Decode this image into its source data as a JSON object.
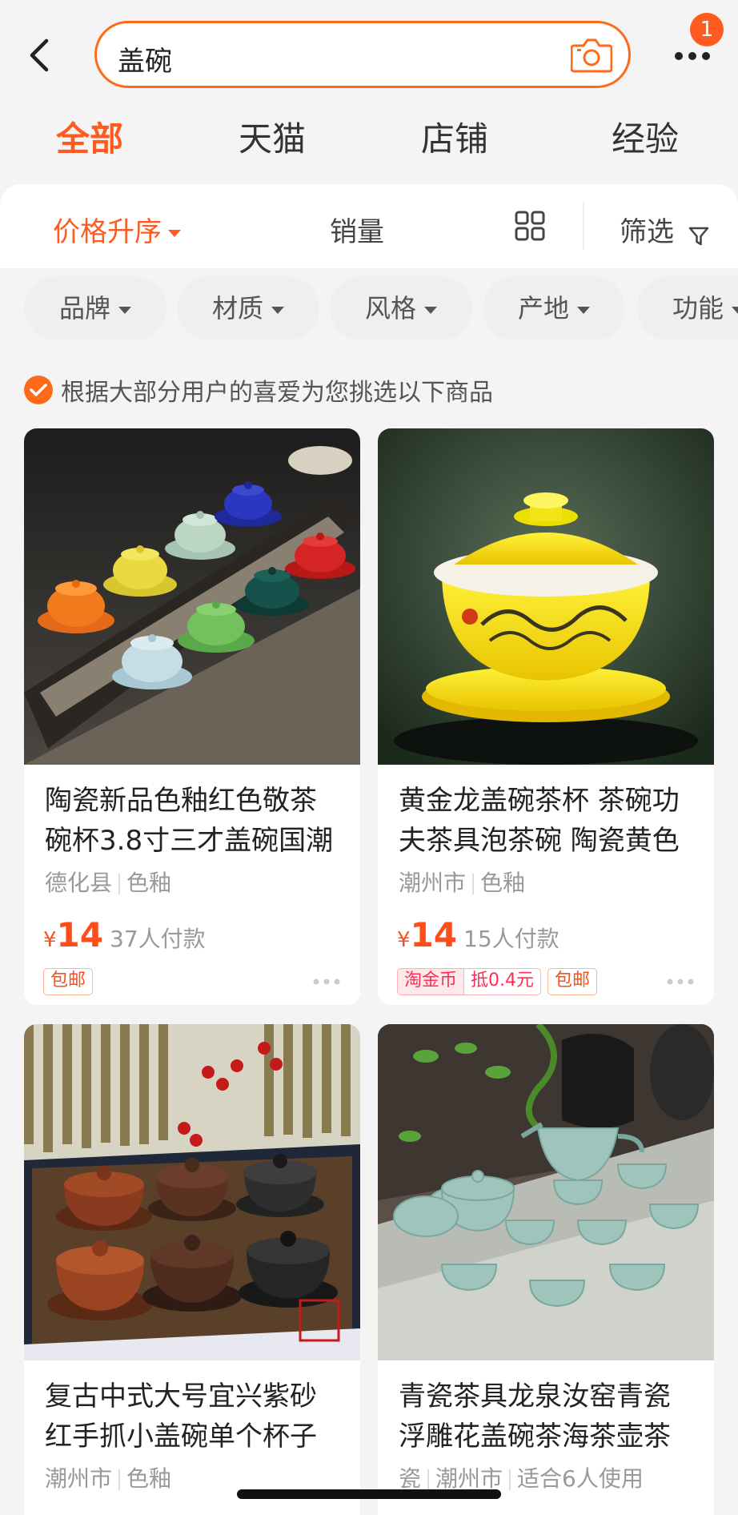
{
  "search": {
    "query": "盖碗",
    "notification_count": "1"
  },
  "tabs": [
    {
      "label": "全部",
      "active": true
    },
    {
      "label": "天猫",
      "active": false
    },
    {
      "label": "店铺",
      "active": false
    },
    {
      "label": "经验",
      "active": false
    }
  ],
  "sort": {
    "price_asc": "价格升序",
    "sales": "销量",
    "filter": "筛选"
  },
  "filter_chips": [
    "品牌",
    "材质",
    "风格",
    "产地",
    "功能"
  ],
  "notice": "根据大部分用户的喜爱为您挑选以下商品",
  "products": [
    {
      "title_line1": "陶瓷新品色釉红色敬茶",
      "title_line2": "碗杯3.8寸三才盖碗国潮",
      "origin": "德化县",
      "attr": "色釉",
      "currency": "¥",
      "price": "14",
      "paid": "37人付款",
      "tags": [
        "包邮"
      ]
    },
    {
      "title_line1": "黄金龙盖碗茶杯 茶碗功",
      "title_line2": "夫茶具泡茶碗 陶瓷黄色",
      "origin": "潮州市",
      "attr": "色釉",
      "currency": "¥",
      "price": "14",
      "paid": "15人付款",
      "tags": [
        "淘金币",
        "抵0.4元",
        "包邮"
      ]
    },
    {
      "title_line1": "复古中式大号宜兴紫砂",
      "title_line2": "红手抓小盖碗单个杯子",
      "origin": "潮州市",
      "attr": "色釉"
    },
    {
      "title_line1": "青瓷茶具龙泉汝窑青瓷",
      "title_line2": "浮雕花盖碗茶海茶壶茶",
      "prefix": "瓷",
      "origin": "潮州市",
      "attr": "适合6人使用"
    }
  ],
  "colors": {
    "accent": "#ff5a1f",
    "price": "#ff4d1a",
    "background": "#f4f4f4"
  },
  "icons": [
    "back-icon",
    "camera-icon",
    "more-icon",
    "grid-view-icon",
    "filter-icon",
    "check-icon",
    "more-dots-icon"
  ]
}
